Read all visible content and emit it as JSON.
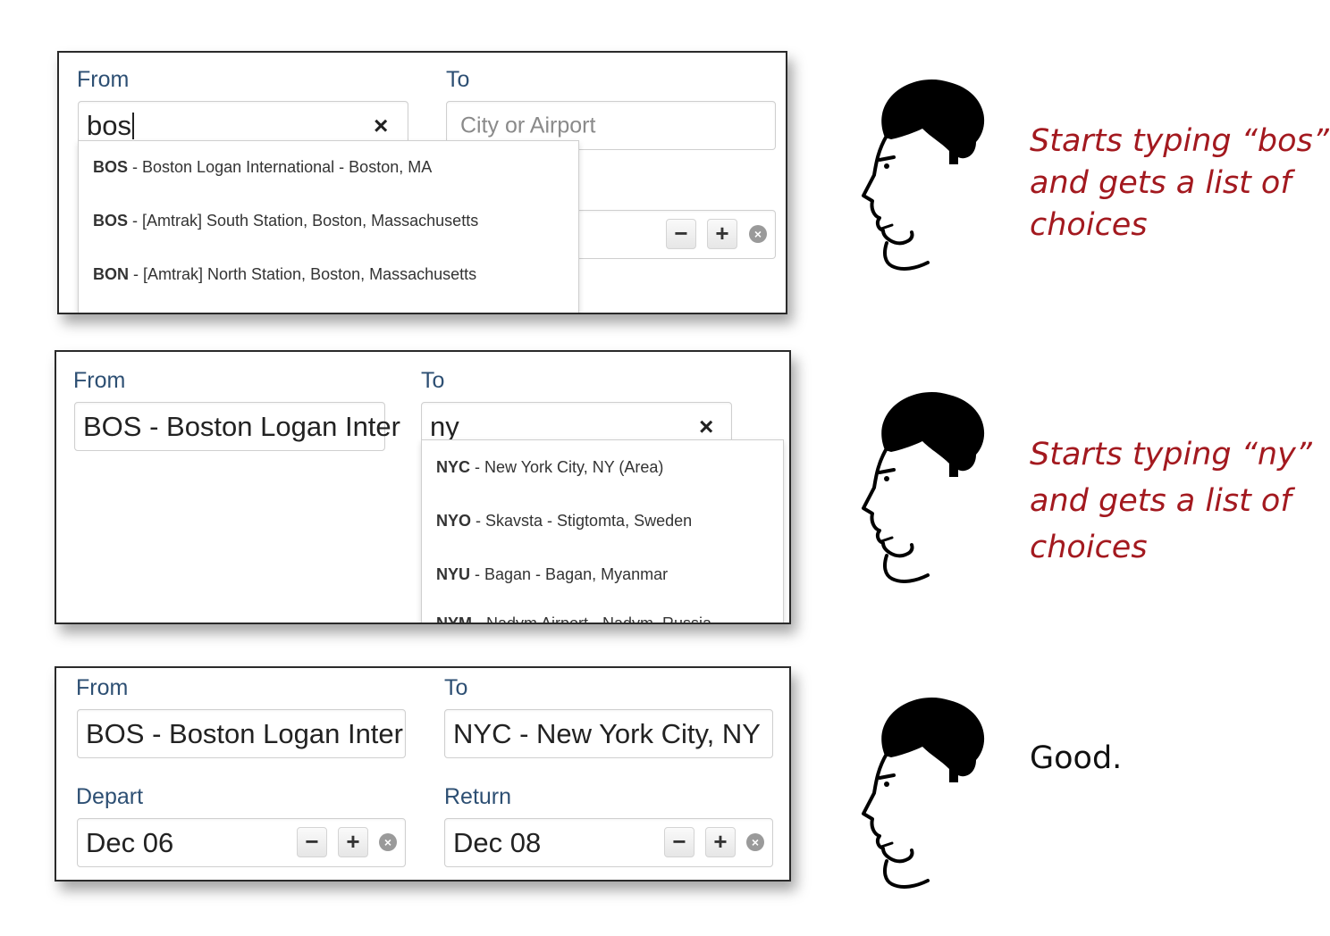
{
  "colors": {
    "caption_red": "#a3191f",
    "label_blue": "#2d4f73",
    "good_black": "#111111"
  },
  "panel1": {
    "from_label": "From",
    "to_label": "To",
    "from_value": "bos",
    "to_placeholder": "City or Airport",
    "suggestions": [
      {
        "code": "BOS",
        "rest": " - Boston Logan International - Boston, MA"
      },
      {
        "code": "BOS",
        "rest": " - [Amtrak] South Station, Boston, Massachusetts"
      },
      {
        "code": "BON",
        "rest": " - [Amtrak] North Station, Boston, Massachusetts"
      }
    ]
  },
  "panel2": {
    "from_label": "From",
    "to_label": "To",
    "from_value": "BOS - Boston Logan Inter",
    "to_value": "ny",
    "suggestions": [
      {
        "code": "NYC",
        "rest": " - New York City, NY (Area)"
      },
      {
        "code": "NYO",
        "rest": " - Skavsta - Stigtomta, Sweden"
      },
      {
        "code": "NYU",
        "rest": " - Bagan - Bagan, Myanmar"
      },
      {
        "code": "NYM",
        "rest": " - Nadym Airport - Nadym, Russia"
      }
    ]
  },
  "panel3": {
    "from_label": "From",
    "to_label": "To",
    "from_value": "BOS - Boston Logan Inter",
    "to_value": "NYC - New York City, NY",
    "depart_label": "Depart",
    "return_label": "Return",
    "depart_value": "Dec 06",
    "return_value": "Dec 08"
  },
  "controls": {
    "minus": "−",
    "plus": "+",
    "clear": "×",
    "reset": "×"
  },
  "captions": {
    "c1": [
      "Starts typing “bos”",
      "and gets a list of",
      "choices"
    ],
    "c2": [
      "Starts typing “ny”",
      "and gets a list of",
      "choices"
    ],
    "c3": "Good."
  },
  "icons": {
    "face": "person-profile-icon",
    "clear": "close-icon",
    "minus": "minus-icon",
    "plus": "plus-icon",
    "reset": "circle-x-icon"
  }
}
